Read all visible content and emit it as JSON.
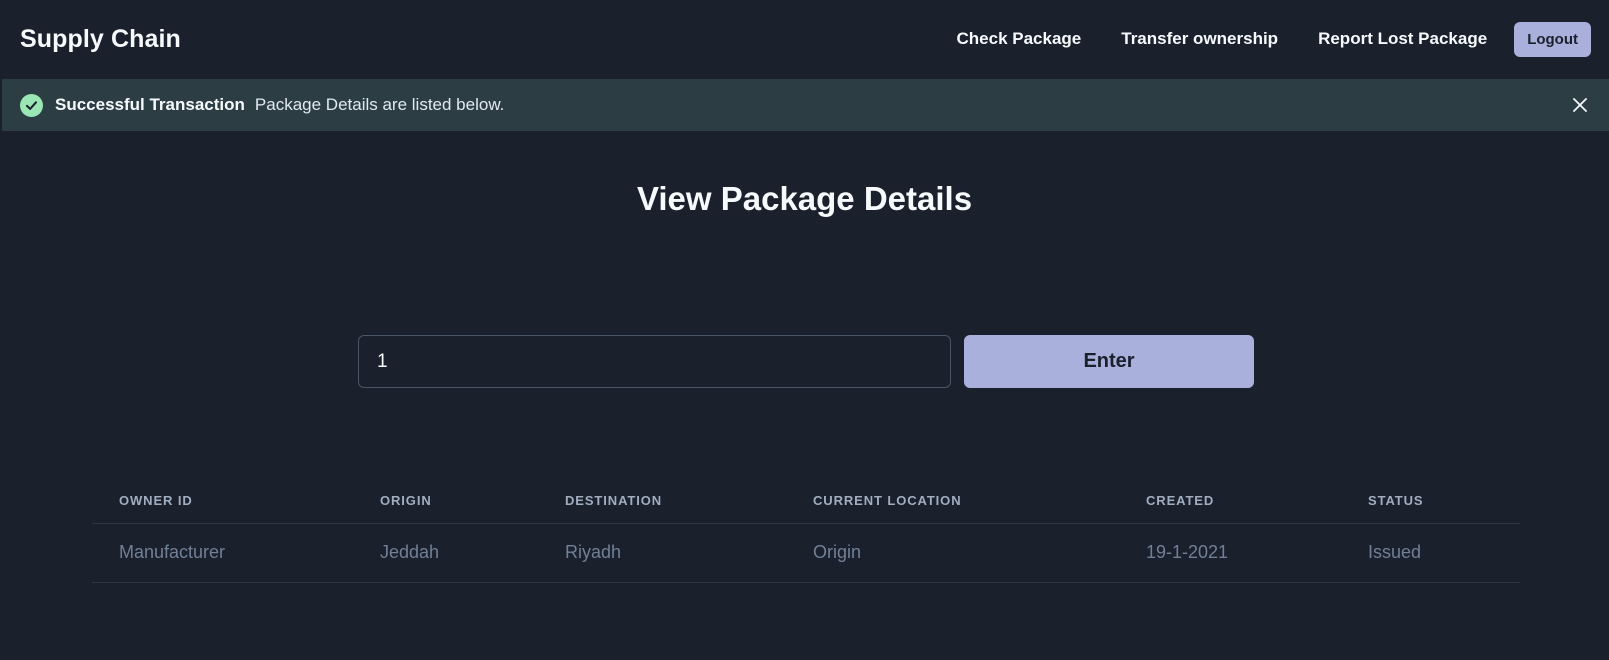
{
  "navbar": {
    "brand": "Supply Chain",
    "links": [
      {
        "label": "Check Package"
      },
      {
        "label": "Transfer ownership"
      },
      {
        "label": "Report Lost Package"
      }
    ],
    "logout_label": "Logout"
  },
  "alert": {
    "status": "success",
    "icon": "check-circle-icon",
    "title": "Successful Transaction",
    "description": "Package Details are listed below.",
    "close_icon": "close-icon"
  },
  "page": {
    "title": "View Package Details"
  },
  "search": {
    "value": "1",
    "button_label": "Enter"
  },
  "table": {
    "columns": [
      "OWNER ID",
      "ORIGIN",
      "DESTINATION",
      "CURRENT LOCATION",
      "CREATED",
      "STATUS"
    ],
    "rows": [
      [
        "Manufacturer",
        "Jeddah",
        "Riyadh",
        "Origin",
        "19-1-2021",
        "Issued"
      ]
    ]
  },
  "colors": {
    "background": "#1a202c",
    "accent": "#a9b0db",
    "success": "#9ae6b4",
    "alert_background": "#2c3e44"
  }
}
